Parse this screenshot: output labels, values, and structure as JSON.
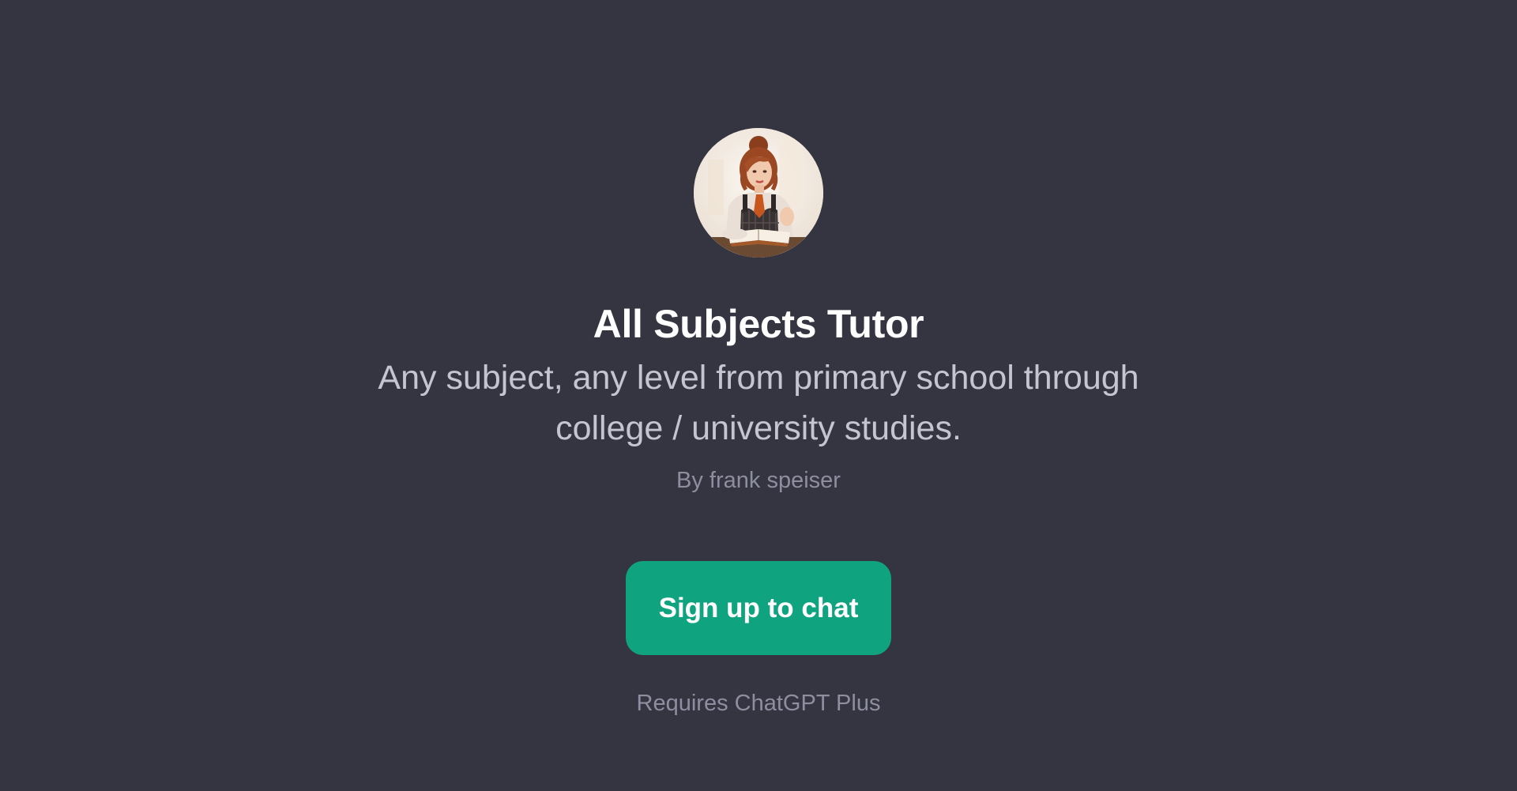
{
  "gpt": {
    "avatar_icon": "tutor-avatar-icon",
    "title": "All Subjects Tutor",
    "description": "Any subject, any level from primary school through college / university studies.",
    "author": "By frank speiser"
  },
  "cta": {
    "label": "Sign up to chat"
  },
  "footer": {
    "requirement": "Requires ChatGPT Plus"
  },
  "colors": {
    "background": "#343541",
    "accent": "#10a37f",
    "title": "#ffffff",
    "description": "#c5c5d2",
    "muted": "#8e8ea0"
  }
}
